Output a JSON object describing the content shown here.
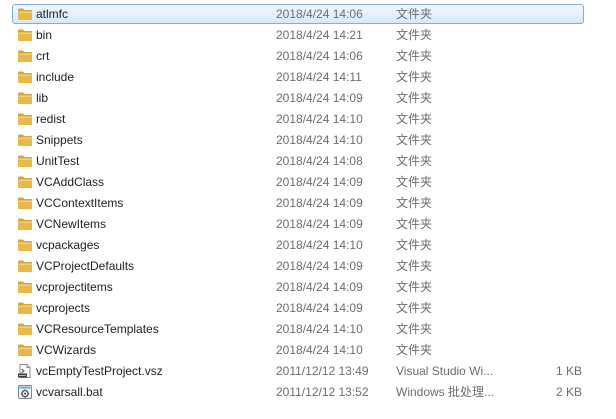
{
  "colors": {
    "folder": "#e8b84a",
    "selection_border": "#84acdd",
    "selection_fill": "#d5e8fd",
    "meta_text": "#6d6d6d"
  },
  "files": [
    {
      "name": "atlmfc",
      "date": "2018/4/24 14:06",
      "type": "文件夹",
      "size": "",
      "icon": "folder-icon",
      "selected": true
    },
    {
      "name": "bin",
      "date": "2018/4/24 14:21",
      "type": "文件夹",
      "size": "",
      "icon": "folder-icon"
    },
    {
      "name": "crt",
      "date": "2018/4/24 14:06",
      "type": "文件夹",
      "size": "",
      "icon": "folder-icon"
    },
    {
      "name": "include",
      "date": "2018/4/24 14:11",
      "type": "文件夹",
      "size": "",
      "icon": "folder-icon"
    },
    {
      "name": "lib",
      "date": "2018/4/24 14:09",
      "type": "文件夹",
      "size": "",
      "icon": "folder-icon"
    },
    {
      "name": "redist",
      "date": "2018/4/24 14:10",
      "type": "文件夹",
      "size": "",
      "icon": "folder-icon"
    },
    {
      "name": "Snippets",
      "date": "2018/4/24 14:10",
      "type": "文件夹",
      "size": "",
      "icon": "folder-icon"
    },
    {
      "name": "UnitTest",
      "date": "2018/4/24 14:08",
      "type": "文件夹",
      "size": "",
      "icon": "folder-icon"
    },
    {
      "name": "VCAddClass",
      "date": "2018/4/24 14:09",
      "type": "文件夹",
      "size": "",
      "icon": "folder-icon"
    },
    {
      "name": "VCContextItems",
      "date": "2018/4/24 14:09",
      "type": "文件夹",
      "size": "",
      "icon": "folder-icon"
    },
    {
      "name": "VCNewItems",
      "date": "2018/4/24 14:09",
      "type": "文件夹",
      "size": "",
      "icon": "folder-icon"
    },
    {
      "name": "vcpackages",
      "date": "2018/4/24 14:10",
      "type": "文件夹",
      "size": "",
      "icon": "folder-icon"
    },
    {
      "name": "VCProjectDefaults",
      "date": "2018/4/24 14:09",
      "type": "文件夹",
      "size": "",
      "icon": "folder-icon"
    },
    {
      "name": "vcprojectitems",
      "date": "2018/4/24 14:09",
      "type": "文件夹",
      "size": "",
      "icon": "folder-icon"
    },
    {
      "name": "vcprojects",
      "date": "2018/4/24 14:09",
      "type": "文件夹",
      "size": "",
      "icon": "folder-icon"
    },
    {
      "name": "VCResourceTemplates",
      "date": "2018/4/24 14:10",
      "type": "文件夹",
      "size": "",
      "icon": "folder-icon"
    },
    {
      "name": "VCWizards",
      "date": "2018/4/24 14:10",
      "type": "文件夹",
      "size": "",
      "icon": "folder-icon"
    },
    {
      "name": "vcEmptyTestProject.vsz",
      "date": "2011/12/12 13:49",
      "type": "Visual Studio Wi...",
      "size": "1 KB",
      "icon": "vsz-file-icon"
    },
    {
      "name": "vcvarsall.bat",
      "date": "2011/12/12 13:52",
      "type": "Windows 批处理...",
      "size": "2 KB",
      "icon": "bat-file-icon"
    }
  ]
}
